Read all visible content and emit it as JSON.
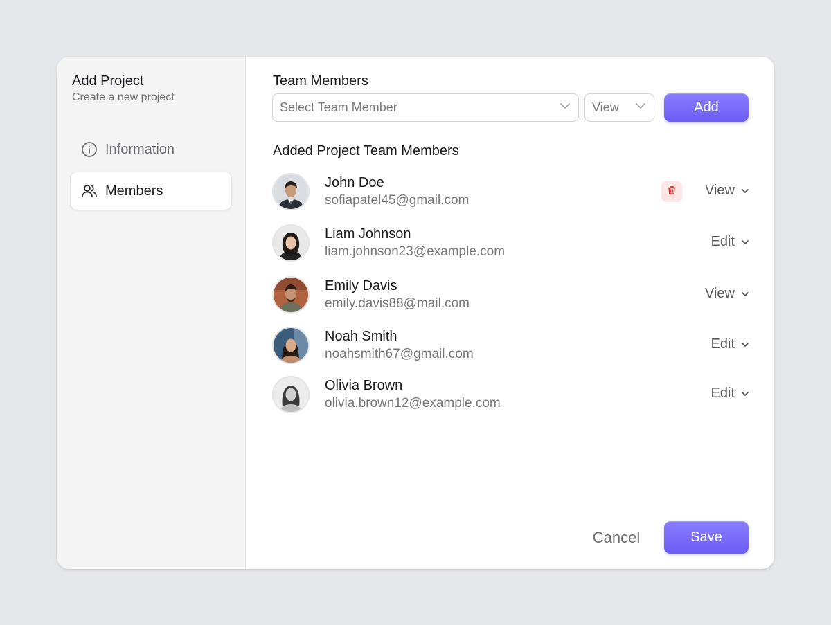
{
  "sidebar": {
    "title": "Add Project",
    "subtitle": "Create a new project",
    "items": [
      {
        "label": "Information",
        "icon": "info-icon",
        "active": false
      },
      {
        "label": "Members",
        "icon": "users-icon",
        "active": true
      }
    ]
  },
  "team": {
    "heading": "Team Members",
    "member_select_placeholder": "Select Team Member",
    "role_select_value": "View",
    "add_label": "Add"
  },
  "added": {
    "heading": "Added Project Team Members",
    "members": [
      {
        "name": "John Doe",
        "email": "sofiapatel45@gmail.com",
        "role": "View",
        "show_delete": true
      },
      {
        "name": "Liam Johnson",
        "email": "liam.johnson23@example.com",
        "role": "Edit",
        "show_delete": false
      },
      {
        "name": "Emily Davis",
        "email": "emily.davis88@mail.com",
        "role": "View",
        "show_delete": false
      },
      {
        "name": "Noah Smith",
        "email": "noahsmith67@gmail.com",
        "role": "Edit",
        "show_delete": false
      },
      {
        "name": "Olivia Brown",
        "email": "olivia.brown12@example.com",
        "role": "Edit",
        "show_delete": false
      }
    ]
  },
  "footer": {
    "cancel_label": "Cancel",
    "save_label": "Save"
  },
  "colors": {
    "accent": "#7566f7",
    "danger_bg": "#fde5e5",
    "danger_icon": "#d12c2c"
  }
}
